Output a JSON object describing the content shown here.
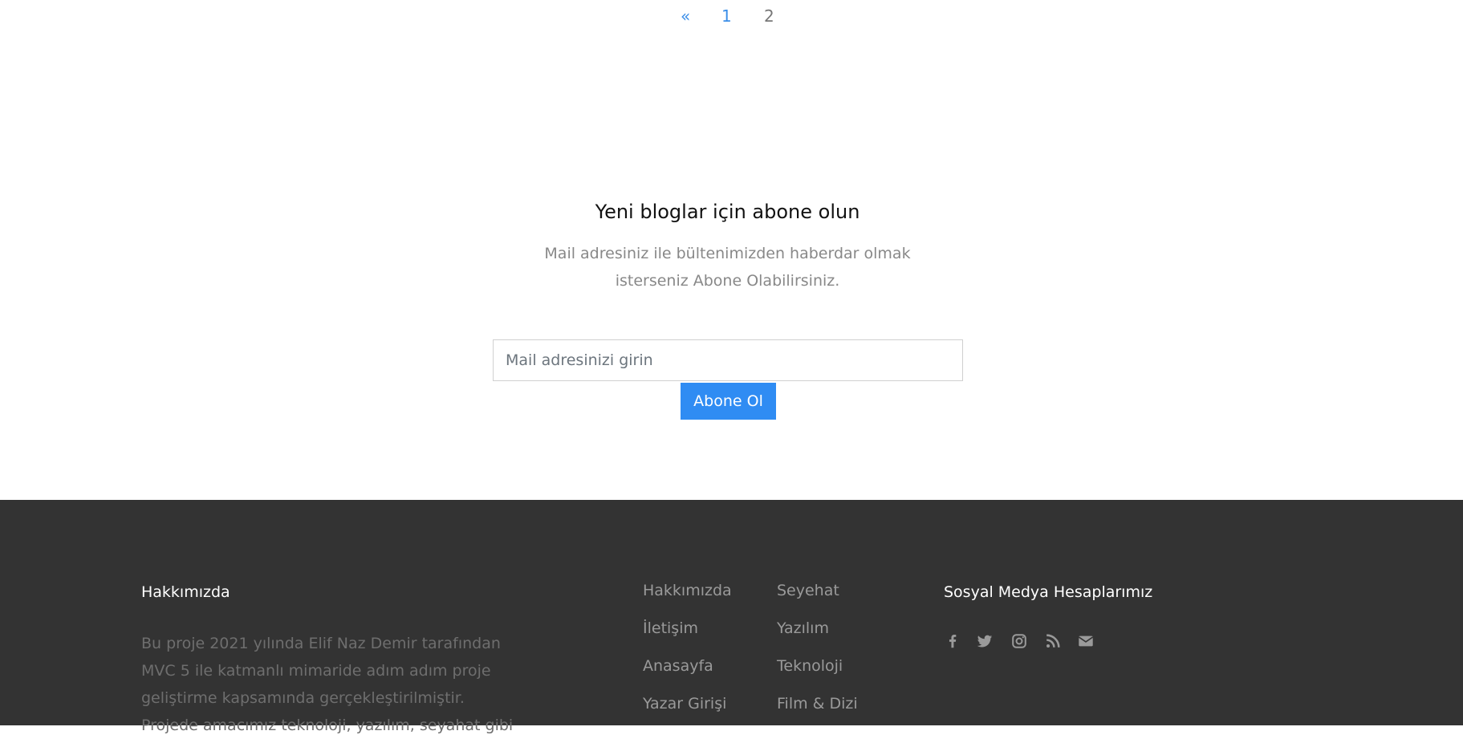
{
  "pagination": {
    "prev": "«",
    "pages": [
      "1",
      "2"
    ]
  },
  "subscribe": {
    "title": "Yeni bloglar için abone olun",
    "description": "Mail adresiniz ile bültenimizden haberdar olmak isterseniz Abone Olabilirsiniz.",
    "email_placeholder": "Mail adresinizi girin",
    "button_label": "Abone Ol"
  },
  "footer": {
    "about_heading": "Hakkımızda",
    "about_text": "Bu proje 2021 yılında Elif Naz Demir tarafından MVC 5 ile katmanlı mimaride adım adım proje geliştirme kapsamında gerçekleştirilmiştir. Projede amacımız teknoloji, yazılım, seyahat gibi",
    "links_col1": [
      "Hakkımızda",
      "İletişim",
      "Anasayfa",
      "Yazar Girişi"
    ],
    "links_col2": [
      "Seyehat",
      "Yazılım",
      "Teknoloji",
      "Film & Dizi"
    ],
    "social_heading": "Sosyal Medya Hesaplarımız",
    "social_icons": [
      "facebook-icon",
      "twitter-icon",
      "instagram-icon",
      "rss-icon",
      "envelope-icon"
    ]
  },
  "colors": {
    "accent": "#2f8cf3",
    "link_blue": "#3b8ee8",
    "footer_bg": "#333333",
    "footer_text_muted": "#6e6e6e",
    "footer_link": "#9a9a9a",
    "icon": "#9a9a9a"
  }
}
